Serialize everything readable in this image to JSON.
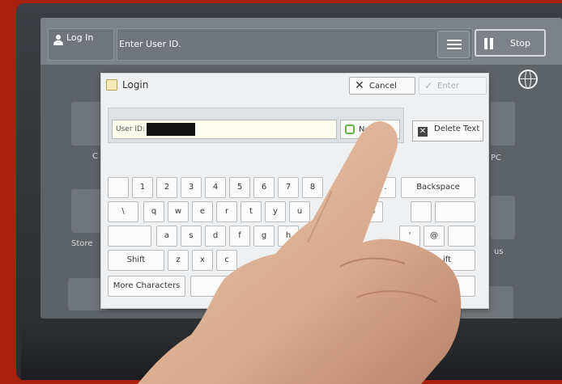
{
  "topbar": {
    "login_label": "Log In",
    "user_id_prompt": "Enter User ID.",
    "stop_label": "Stop"
  },
  "home_tiles": {
    "left_label_1": "C",
    "left_label_2": "Store",
    "right_label_1": "PC",
    "right_label_2": "us"
  },
  "dialog": {
    "title": "Login",
    "cancel_label": "Cancel",
    "enter_label": "Enter",
    "user_id_label": "User ID:",
    "next_label": "Next",
    "delete_text_label": "Delete Text"
  },
  "keyboard": {
    "row1": [
      "1",
      "2",
      "3",
      "4",
      "5",
      "6",
      "7",
      "8"
    ],
    "row1_extra": [
      "-",
      "."
    ],
    "backspace": "Backspace",
    "row2": [
      "\\",
      "q",
      "w",
      "e",
      "r",
      "t",
      "y",
      "u"
    ],
    "row2_extra": [
      "p"
    ],
    "row3": [
      "a",
      "s",
      "d",
      "f",
      "g",
      "h"
    ],
    "row3_extra": [
      "'",
      "@"
    ],
    "shift_left": "Shift",
    "row4": [
      "z",
      "x",
      "c"
    ],
    "shift_right": "ift",
    "more_characters": "More Characters"
  },
  "colors": {
    "background": "#a8200e",
    "screen": "#5d6267",
    "dialog": "#eef0f1",
    "next_icon": "#6bb548"
  }
}
